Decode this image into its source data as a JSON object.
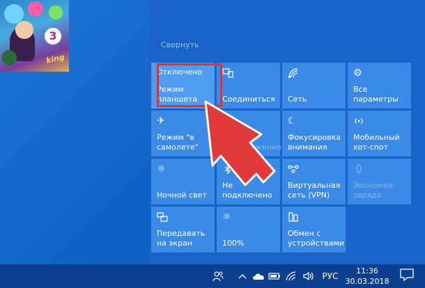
{
  "action_center": {
    "collapse_label": "Свернуть",
    "tiles": [
      {
        "state": "Отключено",
        "label": "Режим планшета",
        "icon": "tablet-mode-icon",
        "enabled": true,
        "highlighted": true
      },
      {
        "label": "Соединиться",
        "icon": "connect-icon",
        "enabled": true
      },
      {
        "label": "Сеть",
        "icon": "network-icon",
        "enabled": true
      },
      {
        "label": "Все параметры",
        "icon": "settings-gear-icon",
        "enabled": true
      },
      {
        "label": "Режим \"в самолете\"",
        "icon": "airplane-icon",
        "enabled": true
      },
      {
        "label": "Расположение",
        "icon": "location-icon",
        "enabled": false
      },
      {
        "label": "Фокусировка внимания",
        "icon": "focus-assist-moon-icon",
        "enabled": true
      },
      {
        "label": "Мобильный хот-спот",
        "icon": "mobile-hotspot-icon",
        "enabled": true
      },
      {
        "label": "Ночной свет",
        "icon": "night-light-icon",
        "enabled": true
      },
      {
        "label": "Не подключено",
        "icon": "bluetooth-icon",
        "enabled": true
      },
      {
        "label": "Виртуальная сеть (VPN)",
        "icon": "vpn-icon",
        "enabled": true
      },
      {
        "label": "Экономия заряда",
        "icon": "battery-saver-icon",
        "enabled": false
      },
      {
        "label": "Передавать на экран",
        "icon": "project-icon",
        "enabled": true
      },
      {
        "label": "100%",
        "icon": "brightness-icon",
        "enabled": true
      },
      {
        "label": "Обмен с устройствами",
        "icon": "nearby-sharing-icon",
        "enabled": true
      }
    ]
  },
  "desktop": {
    "game_number": "3",
    "game_logo": "king"
  },
  "taskbar": {
    "language": "РУС",
    "time": "11:36",
    "date": "30.03.2018"
  },
  "colors": {
    "tile": "#3c8ae8",
    "panel": "#1862c8",
    "taskbar": "#0d3f8f",
    "highlight_box": "#e2322c"
  }
}
